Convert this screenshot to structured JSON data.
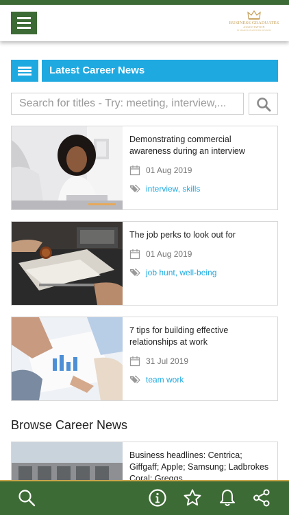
{
  "header": {
    "menu_icon": "hamburger-icon",
    "logo": {
      "line1": "BUSINESS GRADUATES",
      "line2": "ASSOCIATION",
      "line3": "IN SEARCH OF A BETTER BUSINESS",
      "icon": "crown-icon",
      "color": "#c6a15b"
    }
  },
  "section": {
    "title": "Latest Career News",
    "icon": "list-icon",
    "color": "#1fa9e1"
  },
  "search": {
    "placeholder": "Search for titles - Try: meeting, interview,...",
    "button_icon": "search-icon"
  },
  "articles": [
    {
      "title": "Demonstrating commercial awareness during an interview",
      "date": "01 Aug 2019",
      "tags": "interview, skills",
      "image": "woman-smiling-in-meeting-photo"
    },
    {
      "title": "The job perks to look out for",
      "date": "01 Aug 2019",
      "tags": "job hunt, well-being",
      "image": "desk-with-documents-photo"
    },
    {
      "title": "7 tips for building effective relationships at work",
      "date": "31 Jul 2019",
      "tags": "team work",
      "image": "team-hands-on-charts-photo"
    }
  ],
  "browse": {
    "title": "Browse Career News",
    "first_item": {
      "title": "Business headlines: Centrica; Giffgaff; Apple; Samsung; Ladbrokes Coral; Greggs",
      "image": "building-photo"
    }
  },
  "bottom_nav": {
    "items": [
      "search-icon",
      "info-icon",
      "star-icon",
      "bell-icon",
      "share-icon"
    ],
    "color": "#3d6b35"
  }
}
